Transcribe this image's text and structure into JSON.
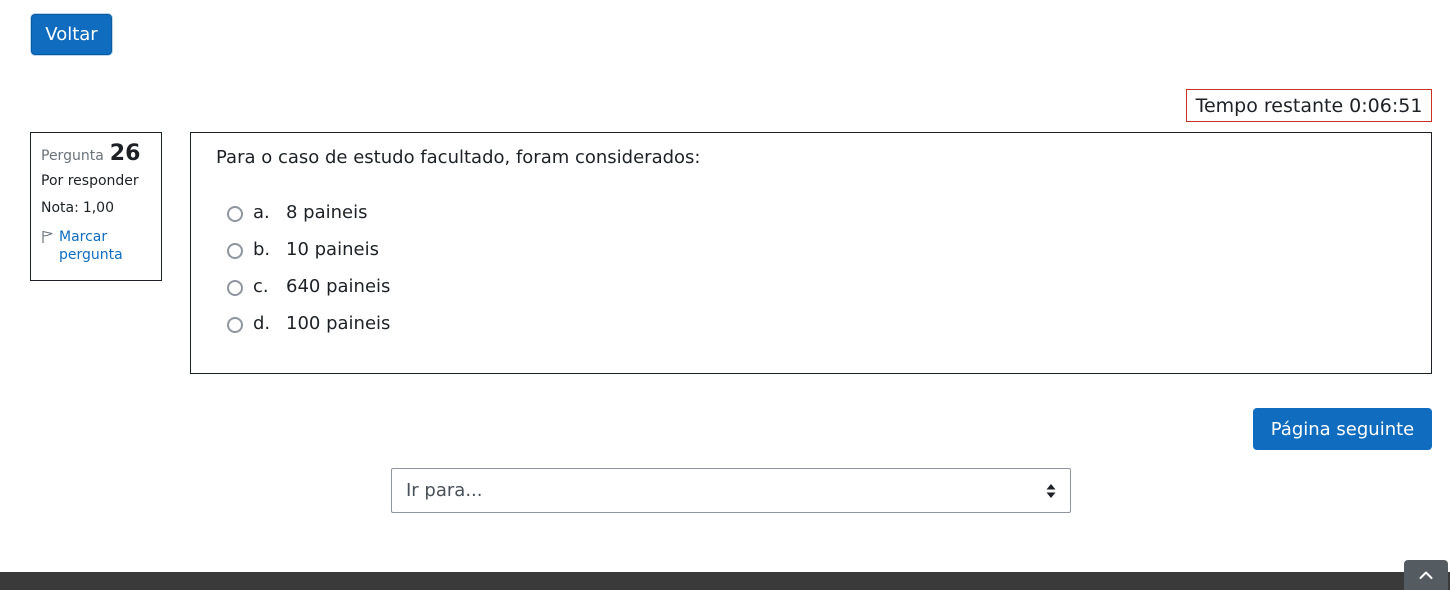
{
  "nav": {
    "back_label": "Voltar"
  },
  "timer": {
    "label": "Tempo restante",
    "value": "0:06:51"
  },
  "question_info": {
    "prefix": "Pergunta",
    "number": "26",
    "state": "Por responder",
    "grade_label": "Nota:",
    "grade_value": "1,00",
    "flag_label": "Marcar pergunta"
  },
  "question": {
    "text": "Para o caso de estudo facultado, foram considerados:",
    "answers": [
      {
        "letter": "a.",
        "text": "8 paineis"
      },
      {
        "letter": "b.",
        "text": "10 paineis"
      },
      {
        "letter": "c.",
        "text": "640 paineis"
      },
      {
        "letter": "d.",
        "text": "100 paineis"
      }
    ]
  },
  "navigation": {
    "next_label": "Página seguinte",
    "jump_placeholder": "Ir para..."
  },
  "colors": {
    "primary": "#0f6cbf",
    "timer_border": "#ca3120",
    "footer": "#3a3a3a"
  },
  "icons": {
    "flag": "flag-outline-icon",
    "select": "sort-arrows-icon",
    "back_to_top": "chevron-up-icon"
  }
}
